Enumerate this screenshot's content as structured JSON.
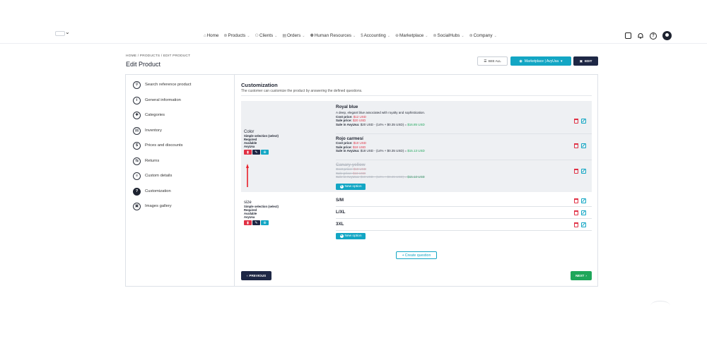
{
  "nav": {
    "items": [
      {
        "icon": "home-icon",
        "label": "Home",
        "caret": false
      },
      {
        "icon": "products-icon",
        "label": "Products",
        "caret": true
      },
      {
        "icon": "clients-icon",
        "label": "Clients",
        "caret": true
      },
      {
        "icon": "orders-icon",
        "label": "Orders",
        "caret": true
      },
      {
        "icon": "hr-icon",
        "label": "Human Resources",
        "caret": true
      },
      {
        "icon": "accounting-icon",
        "label": "Accounting",
        "caret": true
      },
      {
        "icon": "marketplace-icon",
        "label": "Marketplace",
        "caret": true
      },
      {
        "icon": "socialhubs-icon",
        "label": "SocialHubs",
        "caret": true
      },
      {
        "icon": "company-icon",
        "label": "Company",
        "caret": true
      }
    ]
  },
  "header": {
    "breadcrumb": "HOME  /  PRODUCTS  /  EDIT PRODUCT",
    "title": "Edit Product",
    "see_all": "SEE ALL",
    "marketplace": "Marketplace | AvyUsa",
    "edit": "EDIT"
  },
  "sidebar": {
    "items": [
      {
        "label": "Search reference product",
        "icon": "search-icon",
        "glyph": "⚲"
      },
      {
        "label": "General information",
        "icon": "info-icon",
        "glyph": "i"
      },
      {
        "label": "Categories",
        "icon": "categories-icon",
        "glyph": "✱"
      },
      {
        "label": "Inventory",
        "icon": "inventory-icon",
        "glyph": "▤"
      },
      {
        "label": "Prices and discounts",
        "icon": "dollar-icon",
        "glyph": "$"
      },
      {
        "label": "Returns",
        "icon": "returns-icon",
        "glyph": "⇆"
      },
      {
        "label": "Custom details",
        "icon": "list-icon",
        "glyph": "≡"
      },
      {
        "label": "Customization",
        "icon": "question-icon",
        "glyph": "?"
      },
      {
        "label": "Images gallery",
        "icon": "gallery-icon",
        "glyph": "▣"
      }
    ],
    "active": "Customization"
  },
  "customization": {
    "title": "Customization",
    "subtitle": "The customer can customize the product by answering the defined questions.",
    "questions": [
      {
        "name": "Color",
        "meta": [
          "Simple selection (select)",
          "Required",
          "Available",
          "AvyUsa"
        ],
        "options": [
          {
            "name": "Royal blue",
            "description": "A deep, elegant blue associated with royalty and sophistication.",
            "cost_label": "Cost price:",
            "cost": "$12 USD",
            "sale_label": "Sale price:",
            "sale": "$20 USD",
            "sale_in_label": "Sale in AvyUsa:",
            "sale_in": "$20 USD - (14% + $0.35 USD) =",
            "net": "$16.85 USD",
            "disabled": false
          },
          {
            "name": "Rojo carmesí",
            "cost_label": "Cost price:",
            "cost": "$10 USD",
            "sale_label": "Sale price:",
            "sale": "$18 USD",
            "sale_in_label": "Sale in AvyUsa:",
            "sale_in": "$18 USD - (14% + $0.35 USD) =",
            "net": "$15.13 USD",
            "disabled": false
          },
          {
            "name": "Canary yellow",
            "cost_label": "Cost price:",
            "cost": "$10 USD",
            "sale_label": "Sale price:",
            "sale": "$18 USD",
            "sale_in_label": "Sale in AvyUsa:",
            "sale_in": "$18 USD - (14% + $0.35 USD) =",
            "net": "$15.13 USD",
            "disabled": true
          }
        ],
        "new_option": "New option"
      },
      {
        "name": "size",
        "meta": [
          "Simple selection (select)",
          "Required",
          "Available",
          "AvyUsa"
        ],
        "options": [
          {
            "name": "S/M"
          },
          {
            "name": "L/XL"
          },
          {
            "name": "3XL"
          }
        ],
        "new_option": "New option"
      }
    ],
    "create_question": "Create question",
    "previous": "PREVIOUS",
    "next": "NEXT"
  },
  "colors": {
    "primary_navy": "#1e2745",
    "accent_cyan": "#13a6c4",
    "danger_red": "#e03145",
    "success_green": "#1ea65a",
    "annotation_arrow": "#e8202b"
  }
}
